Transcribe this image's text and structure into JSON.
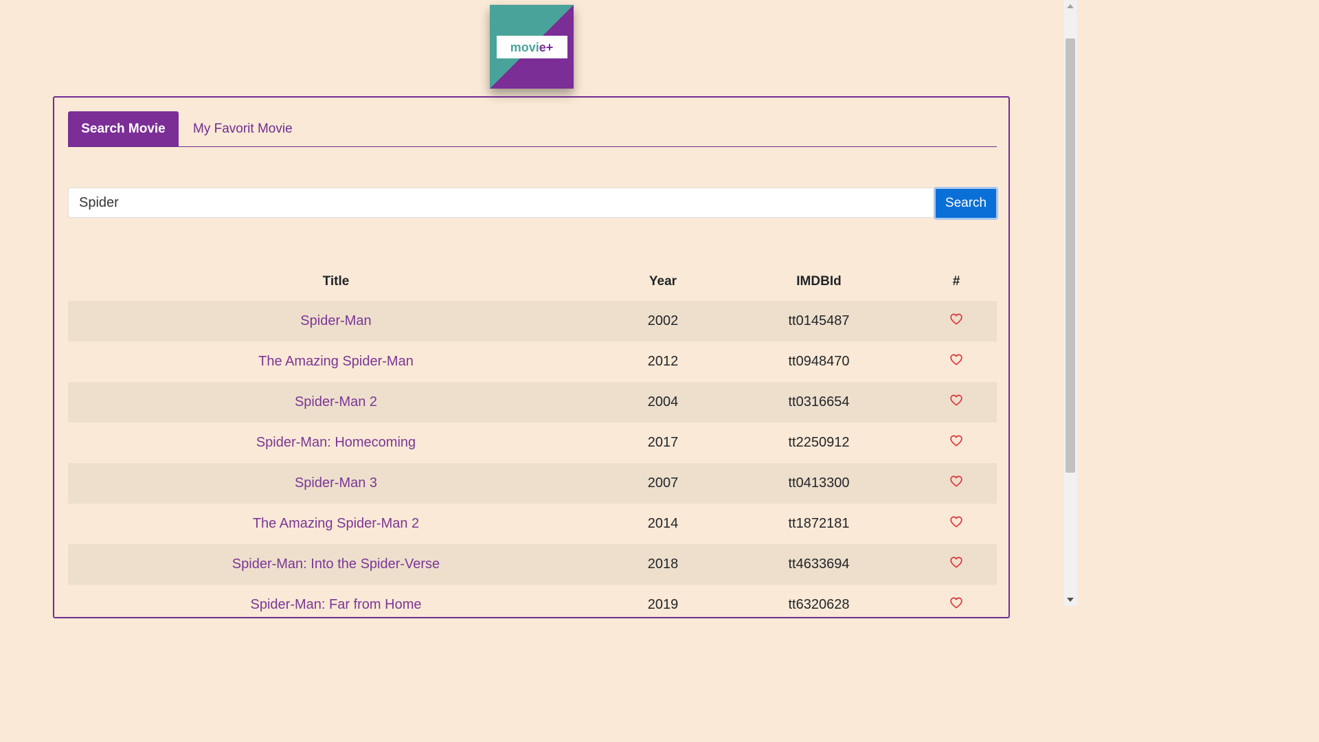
{
  "logo": {
    "text": "movie+"
  },
  "tabs": [
    {
      "label": "Search Movie",
      "active": true
    },
    {
      "label": "My Favorit Movie",
      "active": false
    }
  ],
  "search": {
    "value": "Spider",
    "button_label": "Search"
  },
  "table": {
    "headers": [
      "Title",
      "Year",
      "IMDBId",
      "#"
    ],
    "rows": [
      {
        "title": "Spider-Man",
        "year": "2002",
        "imdb": "tt0145487"
      },
      {
        "title": "The Amazing Spider-Man",
        "year": "2012",
        "imdb": "tt0948470"
      },
      {
        "title": "Spider-Man 2",
        "year": "2004",
        "imdb": "tt0316654"
      },
      {
        "title": "Spider-Man: Homecoming",
        "year": "2017",
        "imdb": "tt2250912"
      },
      {
        "title": "Spider-Man 3",
        "year": "2007",
        "imdb": "tt0413300"
      },
      {
        "title": "The Amazing Spider-Man 2",
        "year": "2014",
        "imdb": "tt1872181"
      },
      {
        "title": "Spider-Man: Into the Spider-Verse",
        "year": "2018",
        "imdb": "tt4633694"
      },
      {
        "title": "Spider-Man: Far from Home",
        "year": "2019",
        "imdb": "tt6320628"
      }
    ]
  },
  "icons": {
    "favorite": "heart-outline-icon"
  },
  "colors": {
    "background": "#fae9d6",
    "accent": "#7b2e96",
    "logo_teal": "#4aa39a",
    "search_button": "#0a6fd6",
    "heart": "#e0303a",
    "row_stripe": "#eddfcc"
  }
}
